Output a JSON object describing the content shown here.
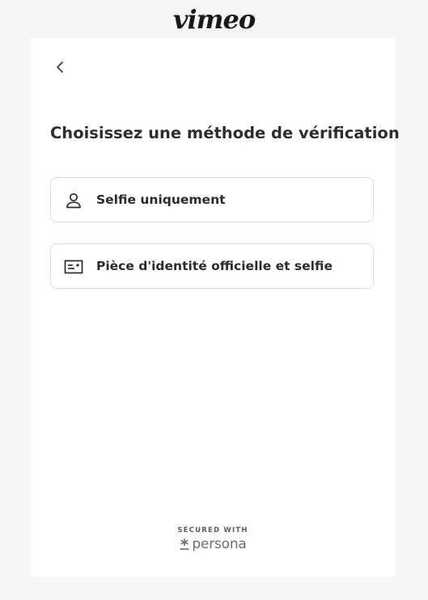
{
  "brand": {
    "logo_text": "vimeo"
  },
  "back": {
    "icon": "chevron-left-icon"
  },
  "title": "Choisissez une méthode de vérification",
  "options": [
    {
      "label": "Selfie uniquement",
      "icon": "person-icon"
    },
    {
      "label": "Pièce d'identité officielle et selfie",
      "icon": "id-card-icon"
    }
  ],
  "footer": {
    "secured_text": "SECURED WITH",
    "provider": "persona",
    "provider_icon": "persona-logo-icon"
  },
  "colors": {
    "page_background": "#f5f6f8",
    "card_background": "#ffffff",
    "option_border": "#d9dbde",
    "text": "#2b2b2b"
  }
}
